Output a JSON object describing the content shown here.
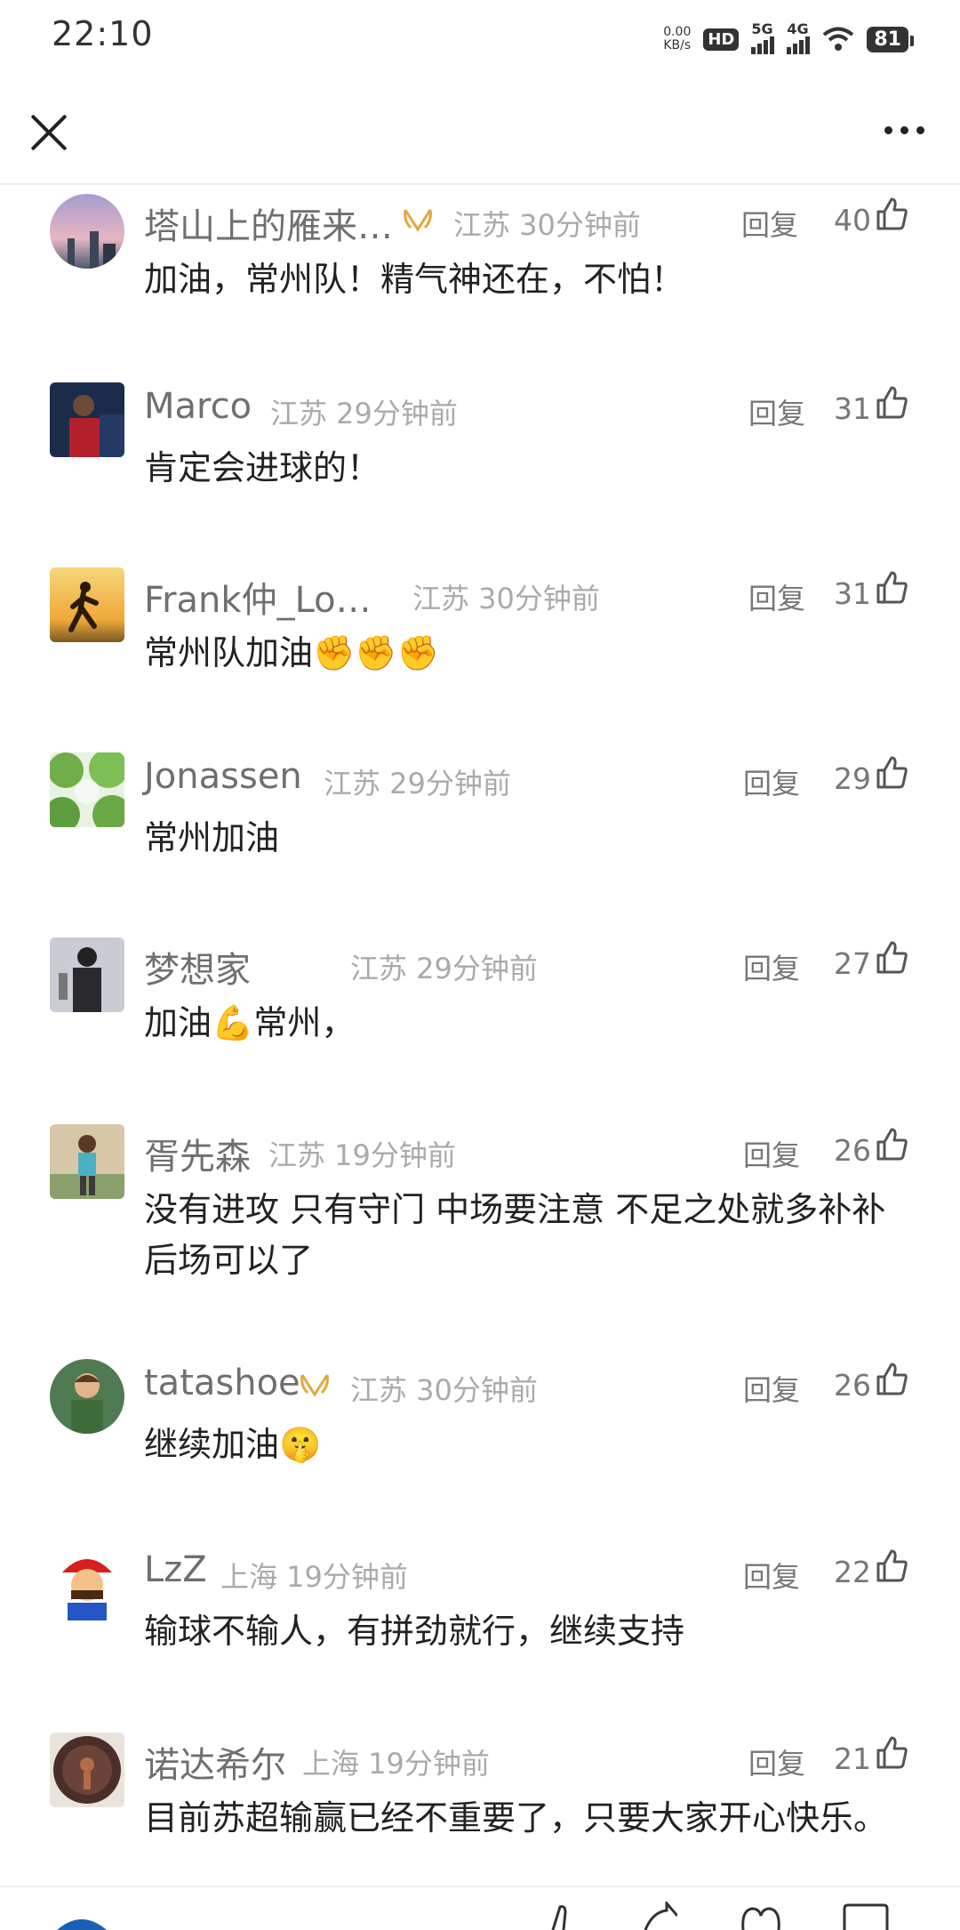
{
  "status": {
    "time": "22:10",
    "net_speed_value": "0.00",
    "net_speed_unit": "KB/s",
    "hd_label": "HD",
    "sim1": "5G",
    "sim2": "4G",
    "battery": "81"
  },
  "header": {
    "close_icon": "close-icon",
    "more_icon": "more-icon"
  },
  "comments": [
    {
      "username": "塔山上的雁来…",
      "vip": true,
      "location": "江苏 30分钟前",
      "reply": "回复",
      "likes": "40",
      "text": "加油，常州队！精气神还在，不怕！"
    },
    {
      "username": "Marco",
      "vip": false,
      "location": "江苏 29分钟前",
      "reply": "回复",
      "likes": "31",
      "text": "肯定会进球的！"
    },
    {
      "username": "Frank仲_Lo…",
      "vip": false,
      "location": "江苏 30分钟前",
      "reply": "回复",
      "likes": "31",
      "text": "常州队加油✊✊✊"
    },
    {
      "username": "Jonassen",
      "vip": false,
      "location": "江苏 29分钟前",
      "reply": "回复",
      "likes": "29",
      "text": "常州加油"
    },
    {
      "username": "梦想家",
      "vip": false,
      "location": "江苏 29分钟前",
      "reply": "回复",
      "likes": "27",
      "text": "加油💪常州，"
    },
    {
      "username": "胥先森",
      "vip": false,
      "location": "江苏 19分钟前",
      "reply": "回复",
      "likes": "26",
      "text": "没有进攻  只有守门  中场要注意  不足之处就多补补  后场可以了"
    },
    {
      "username": "tatashoe",
      "vip": true,
      "location": "江苏 30分钟前",
      "reply": "回复",
      "likes": "26",
      "text": "继续加油🤫"
    },
    {
      "username": "LzZ",
      "vip": false,
      "location": "上海 19分钟前",
      "reply": "回复",
      "likes": "22",
      "text": "输球不输人，有拼劲就行，继续支持"
    },
    {
      "username": "诺达希尔",
      "vip": false,
      "location": "上海 19分钟前",
      "reply": "回复",
      "likes": "21",
      "text": "目前苏超输赢已经不重要了，只要大家开心快乐。"
    }
  ],
  "colors": {
    "vip_badge": "#e3a83c",
    "meta_text": "#aaaaaa",
    "username_text": "#6f6f6f"
  }
}
